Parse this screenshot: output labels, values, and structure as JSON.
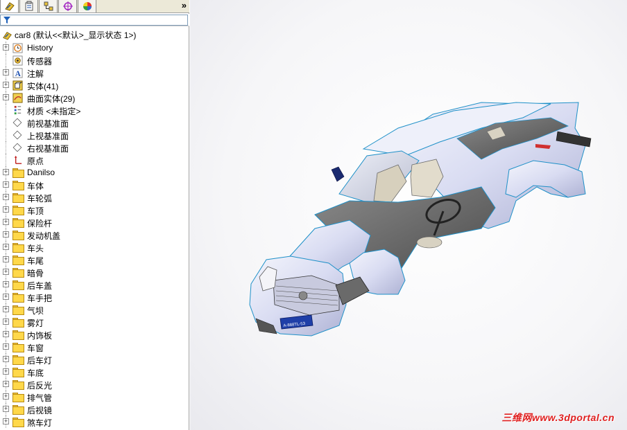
{
  "tabs": [
    {
      "name": "featuremanager",
      "icon": "feature-manager-icon"
    },
    {
      "name": "propertymanager",
      "icon": "property-manager-icon"
    },
    {
      "name": "configurationmanager",
      "icon": "configuration-manager-icon"
    },
    {
      "name": "dimxpert",
      "icon": "dimxpert-icon"
    },
    {
      "name": "displaymanager",
      "icon": "display-manager-icon"
    }
  ],
  "more_label": "»",
  "root": {
    "label": "car8  (默认<<默认>_显示状态 1>)"
  },
  "tree": [
    {
      "label": "History",
      "icon": "history-icon",
      "expandable": true
    },
    {
      "label": "传感器",
      "icon": "sensor-icon",
      "expandable": false
    },
    {
      "label": "注解",
      "icon": "annotation-icon",
      "expandable": true
    },
    {
      "label": "实体(41)",
      "icon": "solid-bodies-icon",
      "expandable": true
    },
    {
      "label": "曲面实体(29)",
      "icon": "surface-bodies-icon",
      "expandable": true
    },
    {
      "label": "材质 <未指定>",
      "icon": "material-icon",
      "expandable": false
    },
    {
      "label": "前视基准面",
      "icon": "plane-icon",
      "expandable": false
    },
    {
      "label": "上视基准面",
      "icon": "plane-icon",
      "expandable": false
    },
    {
      "label": "右视基准面",
      "icon": "plane-icon",
      "expandable": false
    },
    {
      "label": "原点",
      "icon": "origin-icon",
      "expandable": false
    },
    {
      "label": "Danilso",
      "icon": "folder-icon",
      "expandable": true
    },
    {
      "label": "车体",
      "icon": "folder-icon",
      "expandable": true
    },
    {
      "label": "车轮弧",
      "icon": "folder-icon",
      "expandable": true
    },
    {
      "label": "车顶",
      "icon": "folder-icon",
      "expandable": true
    },
    {
      "label": "保险杆",
      "icon": "folder-icon",
      "expandable": true
    },
    {
      "label": "发动机盖",
      "icon": "folder-icon",
      "expandable": true
    },
    {
      "label": "车头",
      "icon": "folder-icon",
      "expandable": true
    },
    {
      "label": "车尾",
      "icon": "folder-icon",
      "expandable": true
    },
    {
      "label": "暗骨",
      "icon": "folder-icon",
      "expandable": true
    },
    {
      "label": "后车盖",
      "icon": "folder-icon",
      "expandable": true
    },
    {
      "label": "车手把",
      "icon": "folder-icon",
      "expandable": true
    },
    {
      "label": "气坝",
      "icon": "folder-icon",
      "expandable": true
    },
    {
      "label": "雾灯",
      "icon": "folder-icon",
      "expandable": true
    },
    {
      "label": "内饰板",
      "icon": "folder-icon",
      "expandable": true
    },
    {
      "label": "车窗",
      "icon": "folder-icon",
      "expandable": true
    },
    {
      "label": "后车灯",
      "icon": "folder-icon",
      "expandable": true
    },
    {
      "label": "车底",
      "icon": "folder-icon",
      "expandable": true
    },
    {
      "label": "后反光",
      "icon": "folder-icon",
      "expandable": true
    },
    {
      "label": "排气管",
      "icon": "folder-icon",
      "expandable": true
    },
    {
      "label": "后视镜",
      "icon": "folder-icon",
      "expandable": true
    },
    {
      "label": "煞车灯",
      "icon": "folder-icon",
      "expandable": true
    }
  ],
  "plate": "A-888TL-53",
  "watermark": "三维网www.3dportal.cn",
  "colors": {
    "body": "#d8dcf0",
    "edge": "#1e90c8",
    "interior": "#6a6a6a",
    "watermark": "#e02020"
  }
}
